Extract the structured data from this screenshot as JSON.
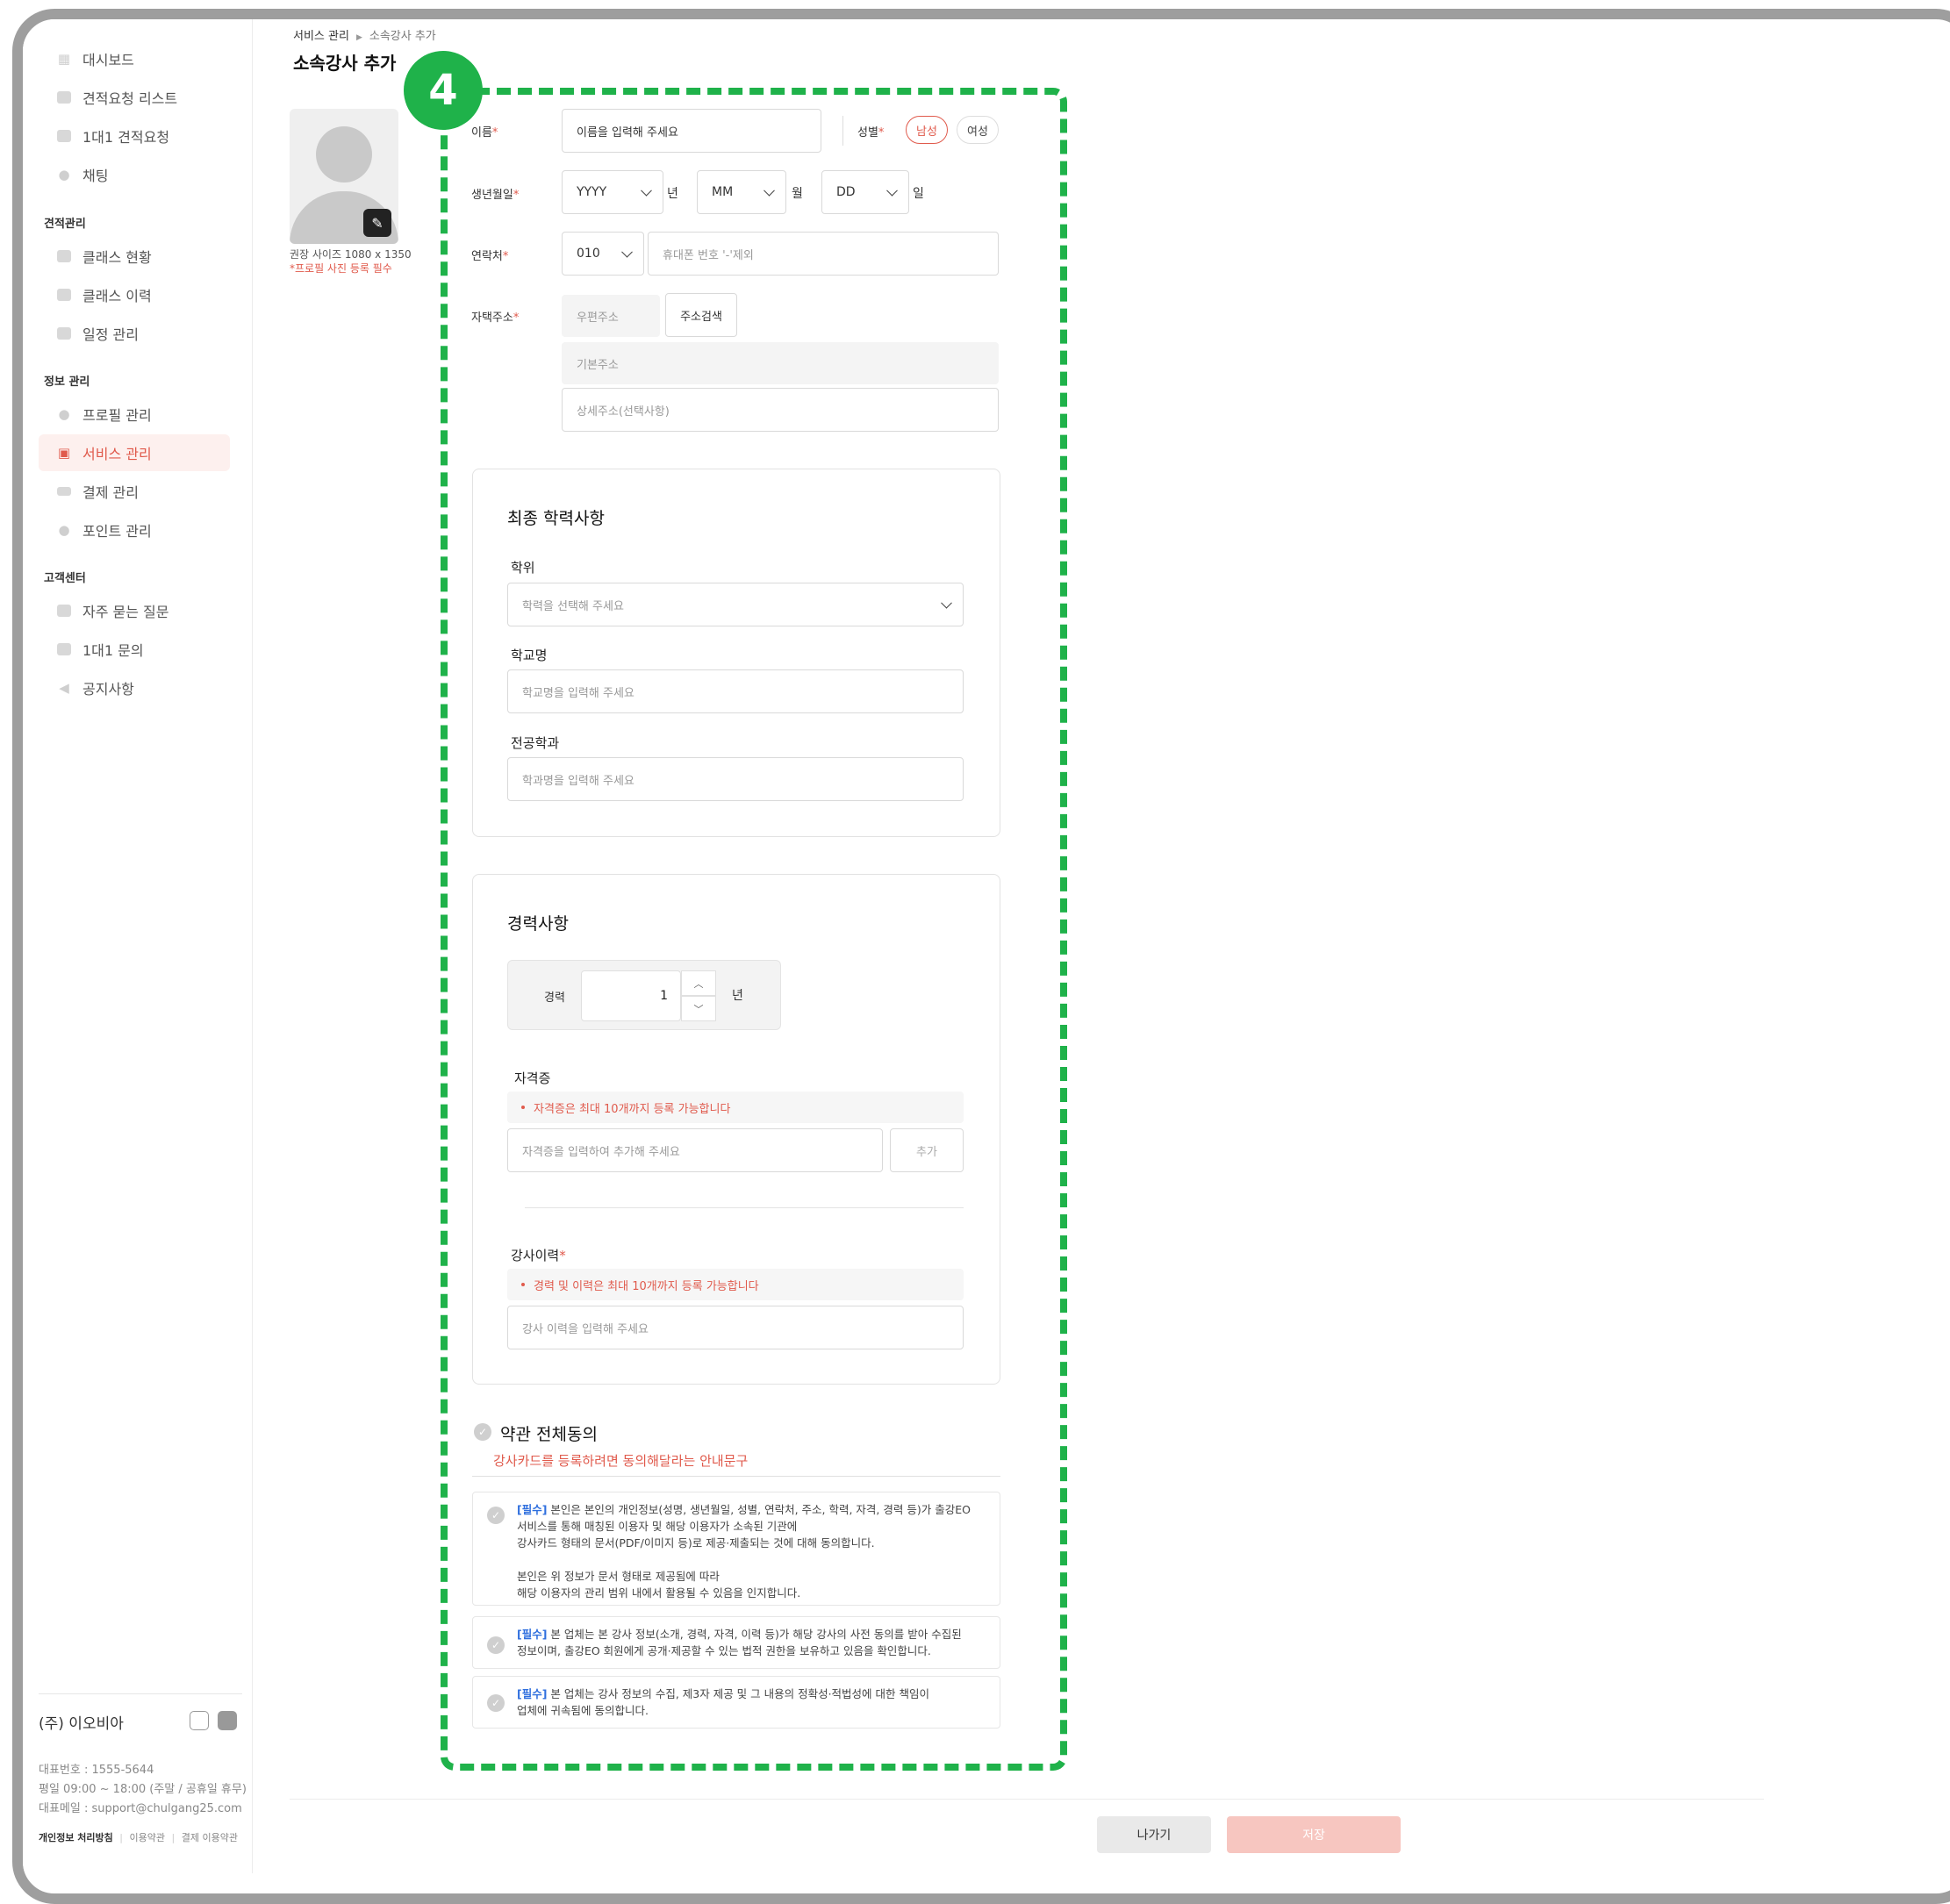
{
  "sidebar": {
    "top_items": [
      {
        "label": "대시보드",
        "icon": "dashboard-icon"
      },
      {
        "label": "견적요청 리스트",
        "icon": "list-icon"
      },
      {
        "label": "1대1 견적요청",
        "icon": "request-icon"
      },
      {
        "label": "채팅",
        "icon": "chat-icon"
      }
    ],
    "sections": [
      {
        "title": "견적관리",
        "items": [
          {
            "label": "클래스 현황",
            "icon": "class-icon"
          },
          {
            "label": "클래스 이력",
            "icon": "history-icon"
          },
          {
            "label": "일정 관리",
            "icon": "calendar-icon"
          }
        ]
      },
      {
        "title": "정보 관리",
        "items": [
          {
            "label": "프로필 관리",
            "icon": "user-icon"
          },
          {
            "label": "서비스 관리",
            "icon": "service-icon",
            "active": true
          },
          {
            "label": "결제 관리",
            "icon": "card-icon"
          },
          {
            "label": "포인트 관리",
            "icon": "point-icon"
          }
        ]
      },
      {
        "title": "고객센터",
        "items": [
          {
            "label": "자주 묻는 질문",
            "icon": "faq-icon"
          },
          {
            "label": "1대1 문의",
            "icon": "inquiry-icon"
          },
          {
            "label": "공지사항",
            "icon": "megaphone-icon"
          }
        ]
      }
    ],
    "footer": {
      "company": "(주) 이오비아",
      "phone": "대표번호 : 1555-5644",
      "hours": "평일 09:00 ~ 18:00 (주말 / 공휴일 휴무)",
      "email": "대표메일 : support@chulgang25.com",
      "links": [
        "개인정보 처리방침",
        "이용약관",
        "결제 이용약관"
      ]
    }
  },
  "header": {
    "breadcrumb": [
      "서비스 관리",
      "소속강사 추가"
    ],
    "title": "소속강사 추가"
  },
  "photo": {
    "size_note": "권장 사이즈 1080 x 1350",
    "required_note": "*프로필 사진 등록 필수"
  },
  "highlight_badge": "4",
  "form": {
    "name": {
      "label": "이름",
      "placeholder": "이름을 입력해 주세요"
    },
    "gender": {
      "label": "성별",
      "options": [
        "남성",
        "여성"
      ],
      "selected": "남성"
    },
    "birth": {
      "label": "생년월일",
      "year": "YYYY",
      "year_unit": "년",
      "month": "MM",
      "month_unit": "월",
      "day": "DD",
      "day_unit": "일"
    },
    "phone": {
      "label": "연락처",
      "prefix": "010",
      "placeholder": "휴대폰 번호 '-'제외"
    },
    "address": {
      "label": "자택주소",
      "zip_placeholder": "우편주소",
      "search_button": "주소검색",
      "base_placeholder": "기본주소",
      "detail_placeholder": "상세주소(선택사항)"
    }
  },
  "education": {
    "title": "최종 학력사항",
    "degree": {
      "label": "학위",
      "placeholder": "학력을 선택해 주세요"
    },
    "school": {
      "label": "학교명",
      "placeholder": "학교명을 입력해 주세요"
    },
    "major": {
      "label": "전공학과",
      "placeholder": "학과명을 입력해 주세요"
    }
  },
  "career": {
    "title": "경력사항",
    "years": {
      "label": "경력",
      "value": "1",
      "unit": "년"
    },
    "certificate": {
      "label": "자격증",
      "notice": "자격증은 최대 10개까지 등록 가능합니다",
      "placeholder": "자격증을 입력하여 추가해 주세요",
      "add_button": "추가"
    },
    "history": {
      "label": "강사이력",
      "notice": "경력 및 이력은 최대 10개까지 등록 가능합니다",
      "placeholder": "강사 이력을 입력해 주세요"
    }
  },
  "terms": {
    "all_label": "약관 전체동의",
    "guide": "강사카드를 등록하려면 동의해달라는 안내문구",
    "items": [
      {
        "tag": "[필수]",
        "lines": [
          "본인은 본인의 개인정보(성명, 생년월일, 성별, 연락처, 주소, 학력, 자격, 경력 등)가 출강EO",
          "서비스를 통해 매칭된 이용자 및 해당 이용자가 소속된 기관에",
          "강사카드 형태의 문서(PDF/이미지 등)로 제공·제출되는 것에 대해 동의합니다.",
          "",
          "본인은 위 정보가 문서 형태로 제공됨에 따라",
          "해당 이용자의 관리 범위 내에서 활용될 수 있음을 인지합니다."
        ]
      },
      {
        "tag": "[필수]",
        "lines": [
          "본 업체는 본 강사 정보(소개, 경력, 자격, 이력 등)가 해당 강사의 사전 동의를 받아 수집된",
          "정보이며, 출강EO 회원에게 공개·제공할 수 있는 법적 권한을 보유하고 있음을 확인합니다."
        ]
      },
      {
        "tag": "[필수]",
        "lines": [
          "본 업체는 강사 정보의 수집, 제3자 제공 및 그 내용의 정확성·적법성에 대한 책임이",
          "업체에 귀속됨에 동의합니다."
        ]
      }
    ]
  },
  "actions": {
    "back": "나가기",
    "save": "저장"
  },
  "colors": {
    "accent": "#e05a4c",
    "highlight": "#1fb24a",
    "link": "#2f6fde"
  }
}
